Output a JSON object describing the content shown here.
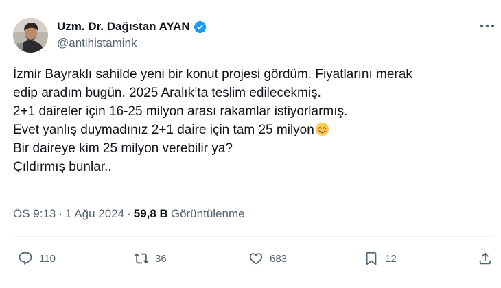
{
  "author": {
    "display_name": "Uzm. Dr. Dağıstan AYAN",
    "handle": "@antihistamink",
    "verified": true
  },
  "tweet": {
    "lines": [
      "İzmir Bayraklı sahilde yeni bir konut projesi gördüm. Fiyatlarını merak",
      "edip aradım bugün. 2025 Aralık’ta teslim edilecekmiş.",
      "2+1 daireler için 16-25 milyon arası rakamlar istiyorlarmış.",
      "Evet yanlış duymadınız 2+1 daire için tam 25 milyon",
      "Bir daireye kim 25 milyon verebilir ya?",
      "Çıldırmış bunlar.."
    ],
    "emoji": "smiling-face-with-smiling-eyes"
  },
  "meta": {
    "time": "ÖS 9:13",
    "separator": "·",
    "date": "1 Ağu 2024",
    "views_count": "59,8 B",
    "views_label": "Görüntülenme"
  },
  "actions": {
    "replies": "110",
    "retweets": "36",
    "likes": "683",
    "bookmarks": "12"
  },
  "colors": {
    "text": "#0f1419",
    "secondary": "#536471",
    "verified": "#1d9bf0",
    "divider": "#eff3f4"
  }
}
